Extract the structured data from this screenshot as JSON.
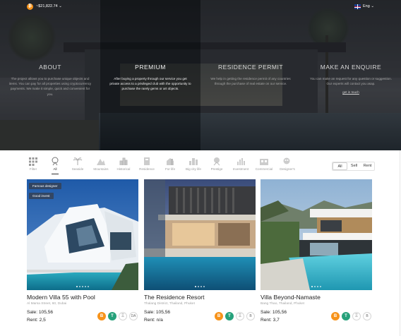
{
  "header": {
    "balance": "~$21,822.74",
    "currency_icon": "bitcoin-icon",
    "language": "Eng"
  },
  "hero": {
    "panels": [
      {
        "title": "ABOUT",
        "text": "The project allows you to purchase unique objects and items. You can pay for all properties using cryptocurrency payments. We make it simple, quick and convenient for you."
      },
      {
        "title": "PREMIUM",
        "text": "After buying a property through our service you get private access to a privileged club with the opportunity to purchase the rarely gems or art objects."
      },
      {
        "title": "RESIDENCE PERMIT",
        "text": "We help in getting the residence permit of any countries through the purchase of real estate on our service."
      },
      {
        "title": "MAKE AN ENQUIRE",
        "text": "You can make an request for any question or suggestion. Our experts will contact you asap.",
        "link": "get in touch"
      }
    ]
  },
  "categories": {
    "filter_label": "Filter",
    "items": [
      {
        "label": "All",
        "icon": "all-icon",
        "active": true
      },
      {
        "label": "Seaside",
        "icon": "palm-icon"
      },
      {
        "label": "Mountains",
        "icon": "mountains-icon"
      },
      {
        "label": "Historical",
        "icon": "historical-icon"
      },
      {
        "label": "Residence",
        "icon": "residence-icon"
      },
      {
        "label": "For life",
        "icon": "house-icon"
      },
      {
        "label": "Big city life",
        "icon": "city-icon"
      },
      {
        "label": "Prestige",
        "icon": "prestige-icon"
      },
      {
        "label": "Investment",
        "icon": "investment-icon"
      },
      {
        "label": "Commercial",
        "icon": "commercial-icon"
      },
      {
        "label": "Designer's",
        "icon": "designer-icon"
      }
    ],
    "segment": [
      "All",
      "Sell",
      "Rent"
    ],
    "segment_active": "All"
  },
  "cards": [
    {
      "title": "Modern Villa 55 with Pool",
      "address": "Al Marsa Street, 60, Dubai",
      "sale": "Sale: 105,56",
      "rent": "Rent: 2,5",
      "badges": [
        "Famous designer",
        "Good invest"
      ]
    },
    {
      "title": "The Residence Resort",
      "address": "Thalang District, Thailand, Phuket",
      "sale": "Sale: 105,56",
      "rent": "Rent: n/a",
      "badges": []
    },
    {
      "title": "Villa Beyond-Namaste",
      "address": "Bang Thao, Thailand, Phuket",
      "sale": "Sale: 105,56",
      "rent": "Rent: 3,7",
      "badges": []
    }
  ],
  "crypto_icons": {
    "card1": [
      "B",
      "T",
      "Ξ",
      "DA"
    ],
    "card2": [
      "B",
      "T",
      "Ξ",
      "B"
    ],
    "card3": [
      "B",
      "T",
      "Ξ",
      "B"
    ]
  }
}
